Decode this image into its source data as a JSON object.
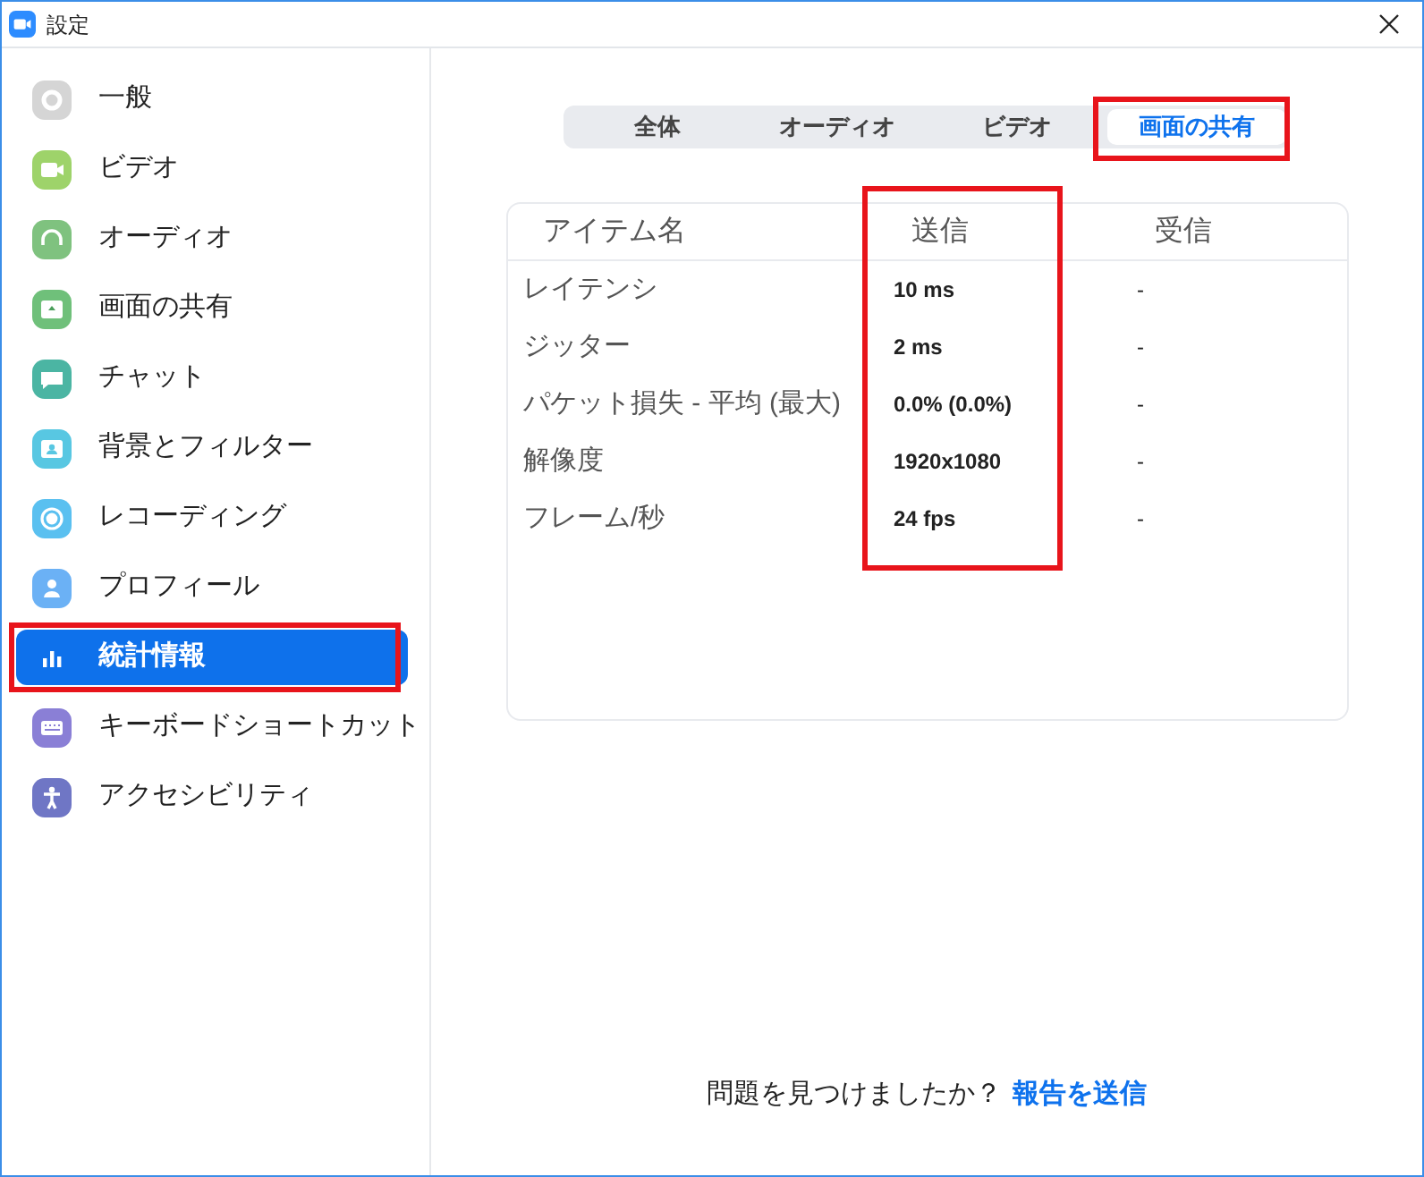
{
  "window": {
    "title": "設定"
  },
  "sidebar": {
    "items": [
      {
        "label": "一般",
        "selected": false,
        "highlighted": false
      },
      {
        "label": "ビデオ",
        "selected": false,
        "highlighted": false
      },
      {
        "label": "オーディオ",
        "selected": false,
        "highlighted": false
      },
      {
        "label": "画面の共有",
        "selected": false,
        "highlighted": false
      },
      {
        "label": "チャット",
        "selected": false,
        "highlighted": false
      },
      {
        "label": "背景とフィルター",
        "selected": false,
        "highlighted": false
      },
      {
        "label": "レコーディング",
        "selected": false,
        "highlighted": false
      },
      {
        "label": "プロフィール",
        "selected": false,
        "highlighted": false
      },
      {
        "label": "統計情報",
        "selected": true,
        "highlighted": true
      },
      {
        "label": "キーボードショートカット",
        "selected": false,
        "highlighted": false
      },
      {
        "label": "アクセシビリティ",
        "selected": false,
        "highlighted": false
      }
    ]
  },
  "tabs": [
    {
      "label": "全体",
      "selected": false,
      "highlighted": false
    },
    {
      "label": "オーディオ",
      "selected": false,
      "highlighted": false
    },
    {
      "label": "ビデオ",
      "selected": false,
      "highlighted": false
    },
    {
      "label": "画面の共有",
      "selected": true,
      "highlighted": true
    }
  ],
  "table": {
    "columns": [
      {
        "label": "アイテム名",
        "highlighted": false
      },
      {
        "label": "送信",
        "highlighted": true
      },
      {
        "label": "受信",
        "highlighted": false
      }
    ],
    "rows": [
      [
        "レイテンシ",
        "10 ms",
        "-"
      ],
      [
        "ジッター",
        "2 ms",
        "-"
      ],
      [
        "パケット損失 - 平均 (最大)",
        "0.0% (0.0%)",
        "-"
      ],
      [
        "解像度",
        "1920x1080",
        "-"
      ],
      [
        "フレーム/秒",
        "24 fps",
        "-"
      ]
    ]
  },
  "footer": {
    "question": "問題を見つけましたか？",
    "link": "報告を送信"
  }
}
